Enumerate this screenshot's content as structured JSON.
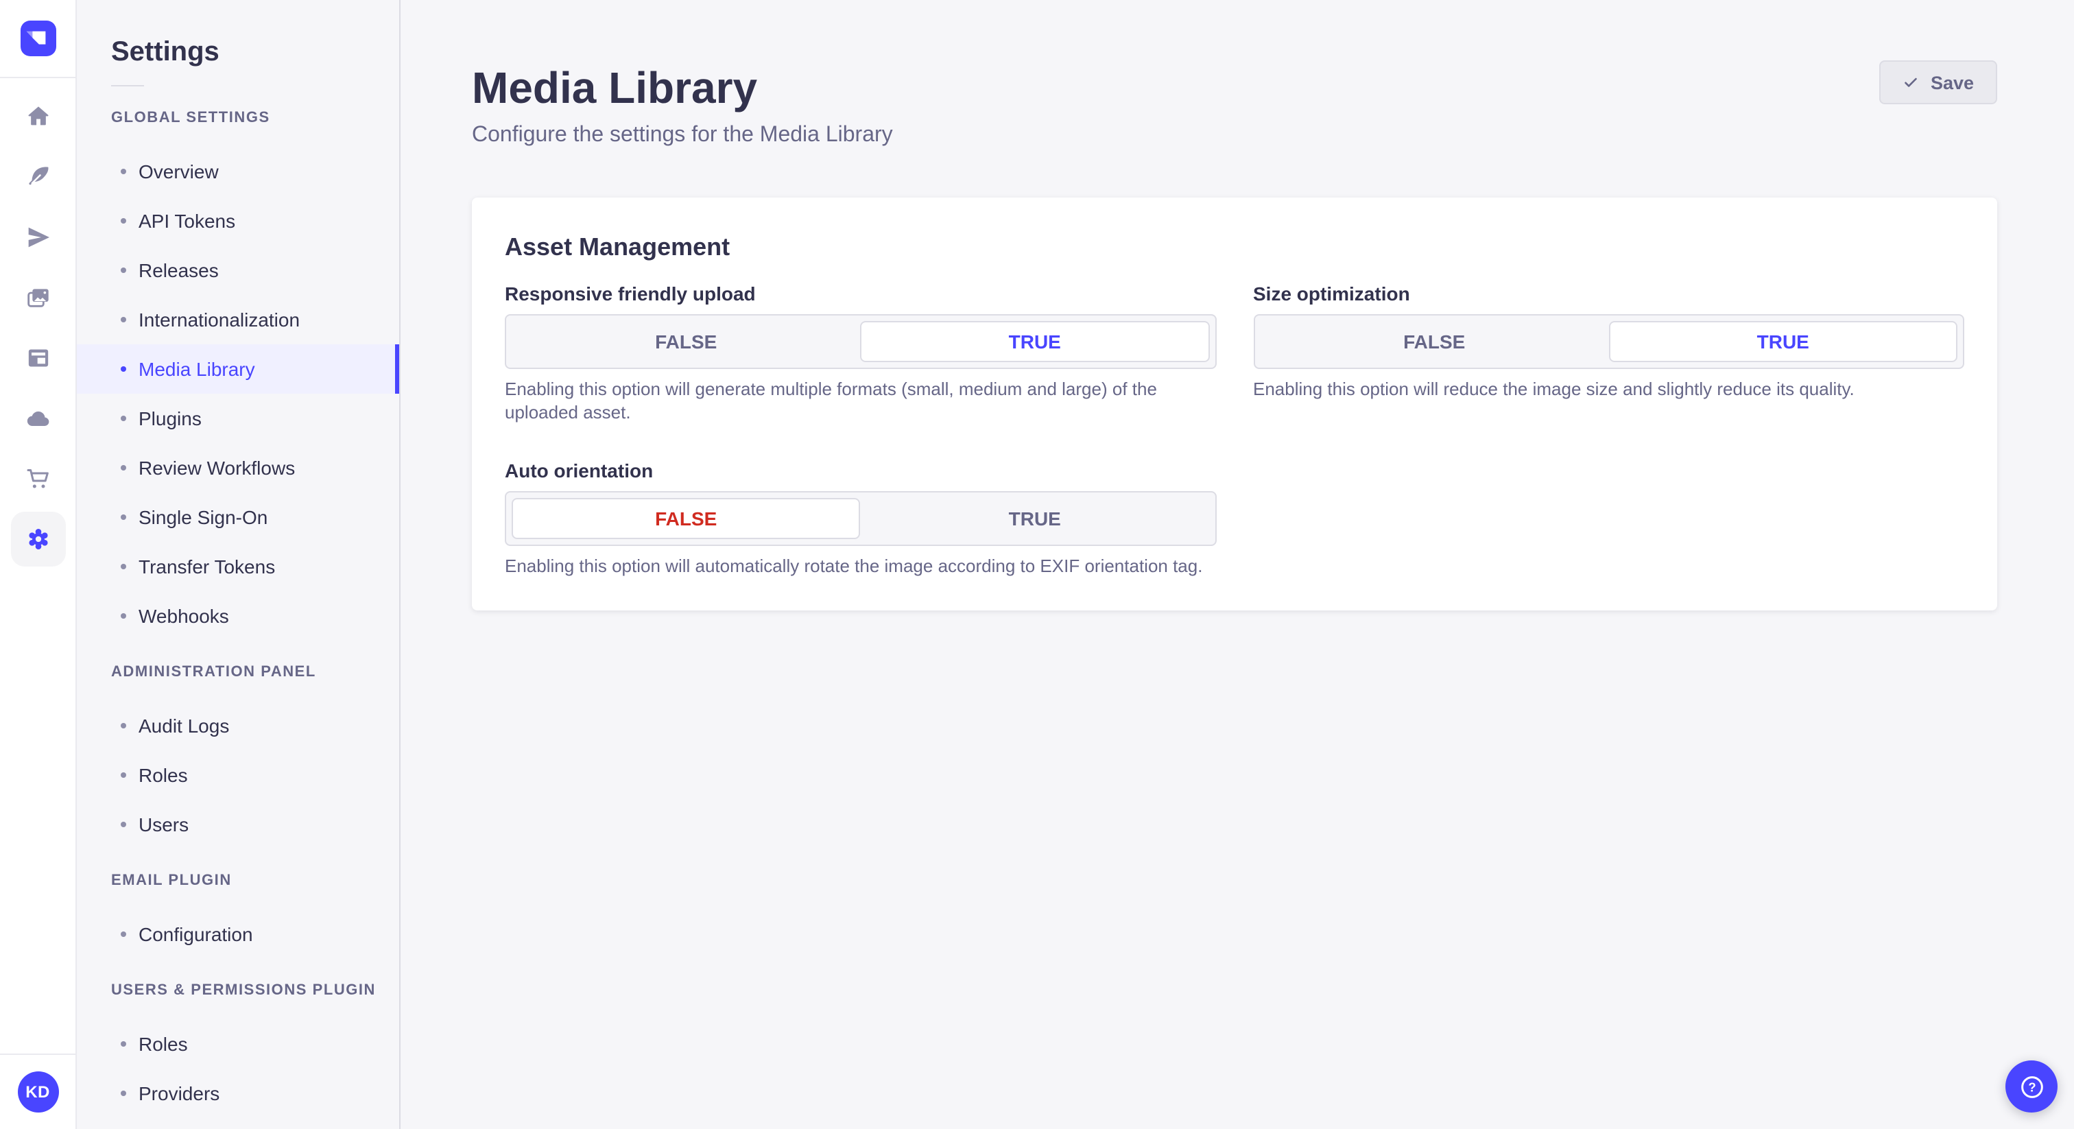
{
  "theme": {
    "primary": "#4945ff",
    "danger": "#d02b20"
  },
  "rail": {
    "logo": {
      "name": "strapi-logo"
    },
    "items": [
      {
        "name": "home",
        "icon": "home-icon"
      },
      {
        "name": "content-type-builder",
        "icon": "feather-icon"
      },
      {
        "name": "releases",
        "icon": "paper-plane-icon"
      },
      {
        "name": "media-library",
        "icon": "picture-icon"
      },
      {
        "name": "content-manager",
        "icon": "layout-icon"
      },
      {
        "name": "cloud",
        "icon": "cloud-icon"
      },
      {
        "name": "marketplace",
        "icon": "cart-icon"
      },
      {
        "name": "settings",
        "icon": "gear-icon",
        "active": true
      }
    ],
    "avatar": {
      "initials": "KD"
    }
  },
  "sidebar": {
    "title": "Settings",
    "sections": [
      {
        "label": "GLOBAL SETTINGS",
        "items": [
          {
            "label": "Overview"
          },
          {
            "label": "API Tokens"
          },
          {
            "label": "Releases"
          },
          {
            "label": "Internationalization"
          },
          {
            "label": "Media Library",
            "active": true
          },
          {
            "label": "Plugins"
          },
          {
            "label": "Review Workflows"
          },
          {
            "label": "Single Sign-On"
          },
          {
            "label": "Transfer Tokens"
          },
          {
            "label": "Webhooks"
          }
        ]
      },
      {
        "label": "ADMINISTRATION PANEL",
        "items": [
          {
            "label": "Audit Logs"
          },
          {
            "label": "Roles"
          },
          {
            "label": "Users"
          }
        ]
      },
      {
        "label": "EMAIL PLUGIN",
        "items": [
          {
            "label": "Configuration"
          }
        ]
      },
      {
        "label": "USERS & PERMISSIONS PLUGIN",
        "items": [
          {
            "label": "Roles"
          },
          {
            "label": "Providers"
          }
        ]
      }
    ]
  },
  "main": {
    "title": "Media Library",
    "subtitle": "Configure the settings for the Media Library",
    "save": {
      "label": "Save",
      "icon": "check-icon"
    }
  },
  "card": {
    "title": "Asset Management",
    "fields": [
      {
        "label": "Responsive friendly upload",
        "options": [
          "FALSE",
          "TRUE"
        ],
        "value": "TRUE",
        "helper": "Enabling this option will generate multiple formats (small, medium and large) of the uploaded asset."
      },
      {
        "label": "Size optimization",
        "options": [
          "FALSE",
          "TRUE"
        ],
        "value": "TRUE",
        "helper": "Enabling this option will reduce the image size and slightly reduce its quality."
      },
      {
        "label": "Auto orientation",
        "options": [
          "FALSE",
          "TRUE"
        ],
        "value": "FALSE",
        "helper": "Enabling this option will automatically rotate the image according to EXIF orientation tag."
      }
    ]
  },
  "help": {
    "icon": "question-mark-icon"
  }
}
